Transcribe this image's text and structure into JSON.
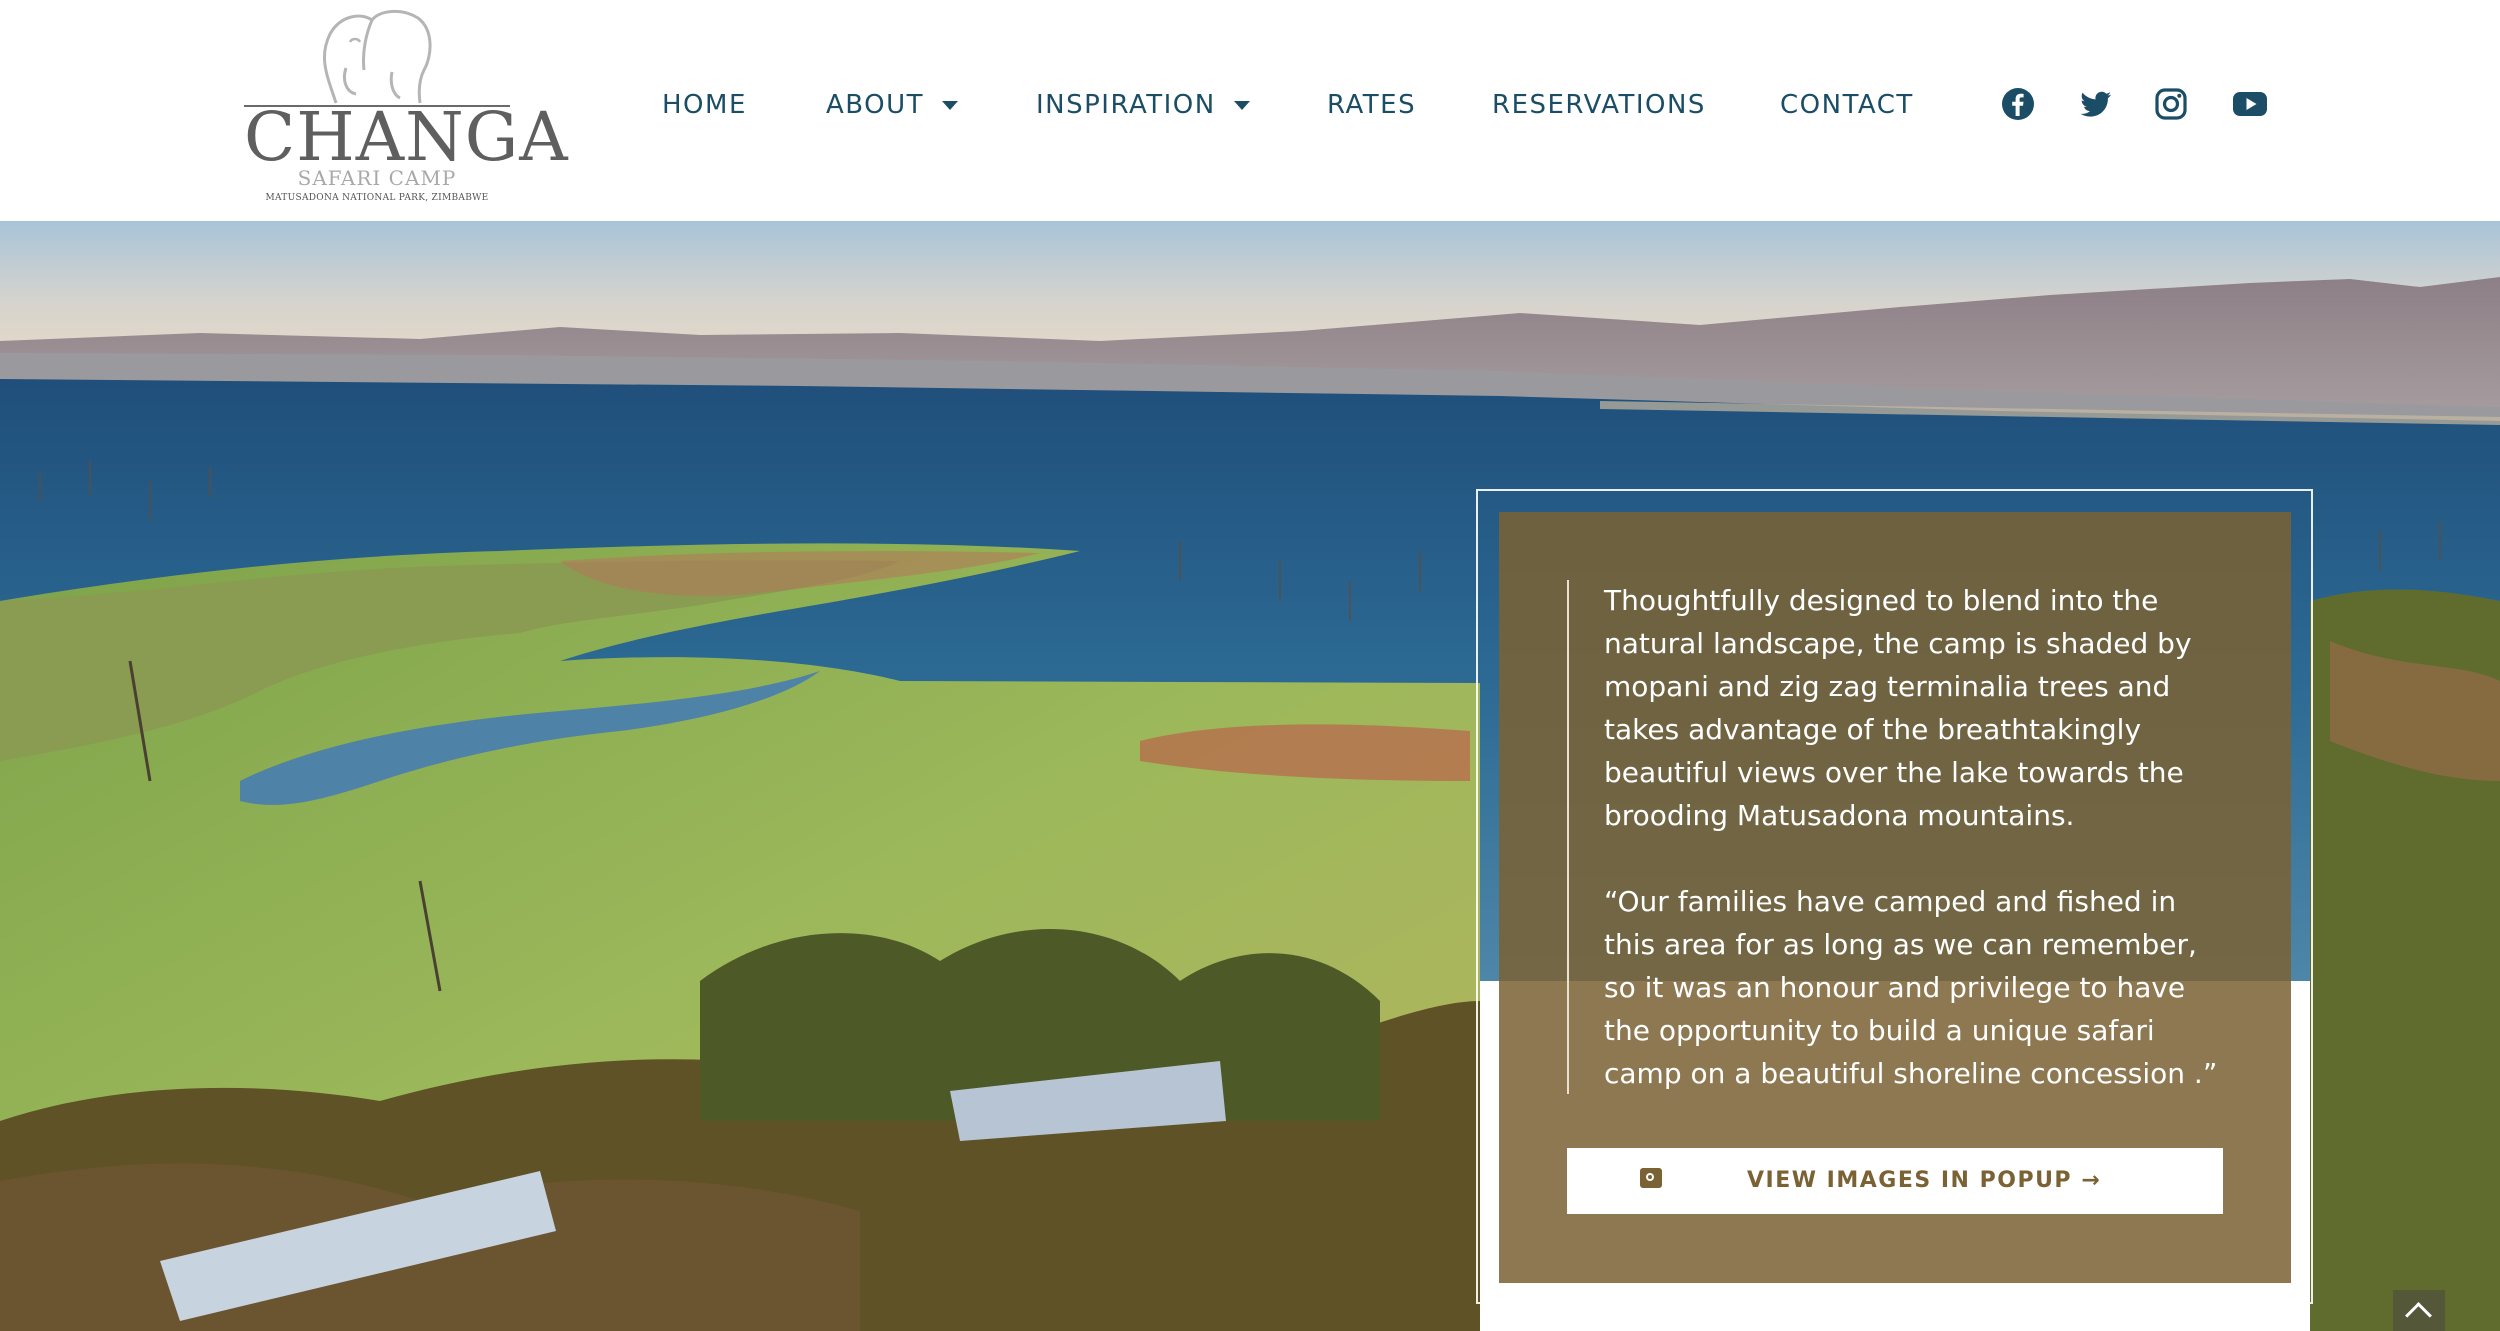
{
  "logo": {
    "wordmark": "CHANGA",
    "subtitle": "SAFARI CAMP",
    "tagline": "MATUSADONA NATIONAL PARK, ZIMBABWE",
    "icon": "elephant-icon"
  },
  "nav": {
    "items": [
      {
        "label": "HOME",
        "has_dropdown": false
      },
      {
        "label": "ABOUT",
        "has_dropdown": true
      },
      {
        "label": "INSPIRATION",
        "has_dropdown": true
      },
      {
        "label": "RATES",
        "has_dropdown": false
      },
      {
        "label": "RESERVATIONS",
        "has_dropdown": false
      },
      {
        "label": "CONTACT",
        "has_dropdown": false
      }
    ],
    "color": "#1b4e66"
  },
  "social": [
    "facebook-icon",
    "twitter-icon",
    "instagram-icon",
    "youtube-icon"
  ],
  "hero": {
    "paragraphs": [
      "Thoughtfully designed to blend into the natural landscape, the camp is shaded by mopani and zig zag terminalia trees and takes advantage of the breathtakingly beautiful views over the lake towards the brooding Matusadona mountains.",
      "“Our families have camped and fished in this area for as long as we can remember, so it was an honour and privilege to have the opportunity to build a unique safari camp on a beautiful shoreline concession .”"
    ],
    "button_label": "VIEW IMAGES IN POPUP →",
    "button_icon": "camera-icon",
    "panel_color": "#7a6234"
  }
}
